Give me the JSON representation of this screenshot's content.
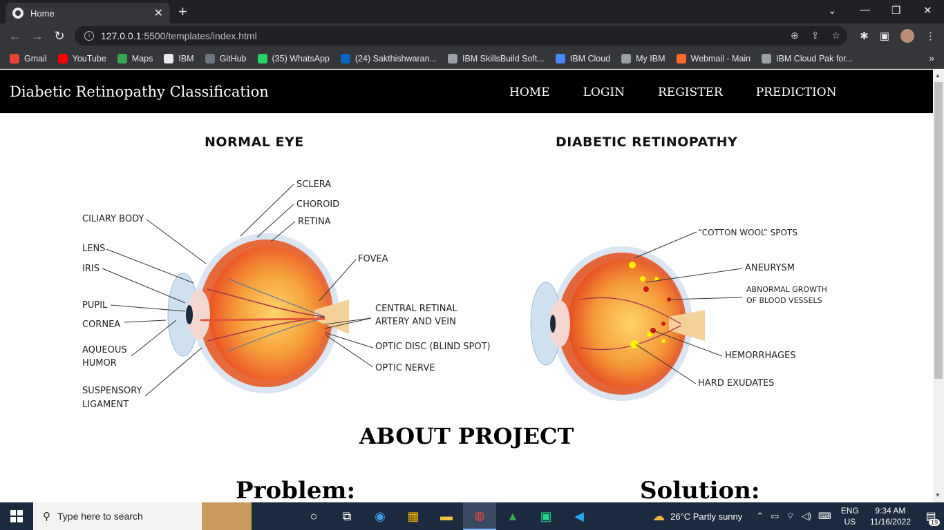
{
  "browser": {
    "tab_title": "Home",
    "url_host": "127.0.0.1",
    "url_rest": ":5500/templates/index.html",
    "bookmarks": [
      {
        "label": "Gmail",
        "color": "#ea4335"
      },
      {
        "label": "YouTube",
        "color": "#ff0000"
      },
      {
        "label": "Maps",
        "color": "#34a853"
      },
      {
        "label": "IBM",
        "color": "#e8eaed"
      },
      {
        "label": "GitHub",
        "color": "#6e7681"
      },
      {
        "label": "(35) WhatsApp",
        "color": "#25d366"
      },
      {
        "label": "(24) Sakthishwaran...",
        "color": "#0a66c2"
      },
      {
        "label": "IBM SkillsBuild Soft...",
        "color": "#9aa0a6"
      },
      {
        "label": "IBM Cloud",
        "color": "#4589ff"
      },
      {
        "label": "My IBM",
        "color": "#9aa0a6"
      },
      {
        "label": "Webmail - Main",
        "color": "#ff6c2c"
      },
      {
        "label": "IBM Cloud Pak for...",
        "color": "#9aa0a6"
      }
    ]
  },
  "site": {
    "brand": "Diabetic Retinopathy Classification",
    "nav": [
      "HOME",
      "LOGIN",
      "REGISTER",
      "PREDICTION"
    ],
    "normal_eye": {
      "heading": "NORMAL EYE",
      "labels": {
        "sclera": "SCLERA",
        "choroid": "CHOROID",
        "retina": "RETINA",
        "ciliary_body": "CILIARY BODY",
        "lens": "LENS",
        "iris": "IRIS",
        "fovea": "FOVEA",
        "pupil": "PUPIL",
        "central_retinal_1": "CENTRAL RETINAL",
        "central_retinal_2": "ARTERY AND VEIN",
        "cornea": "CORNEA",
        "optic_disc": "OPTIC DISC (BLIND SPOT)",
        "aqueous_1": "AQUEOUS",
        "aqueous_2": "HUMOR",
        "optic_nerve": "OPTIC NERVE",
        "suspensory_1": "SUSPENSORY",
        "suspensory_2": "LIGAMENT"
      }
    },
    "dr_eye": {
      "heading": "DIABETIC RETINOPATHY",
      "labels": {
        "cotton": "“COTTON WOOL” SPOTS",
        "aneurysm": "ANEURYSM",
        "abnormal_1": "ABNORMAL GROWTH",
        "abnormal_2": "OF BLOOD VESSELS",
        "hemorrhages": "HEMORRHAGES",
        "hard_exudates": "HARD EXUDATES"
      }
    },
    "about_title": "ABOUT PROJECT",
    "problem_title": "Problem:",
    "solution_title": "Solution:"
  },
  "taskbar": {
    "search_placeholder": "Type here to search",
    "weather": "26°C  Partly sunny",
    "lang_1": "ENG",
    "lang_2": "US",
    "time": "9:34 AM",
    "date": "11/16/2022",
    "notifications": "19"
  }
}
